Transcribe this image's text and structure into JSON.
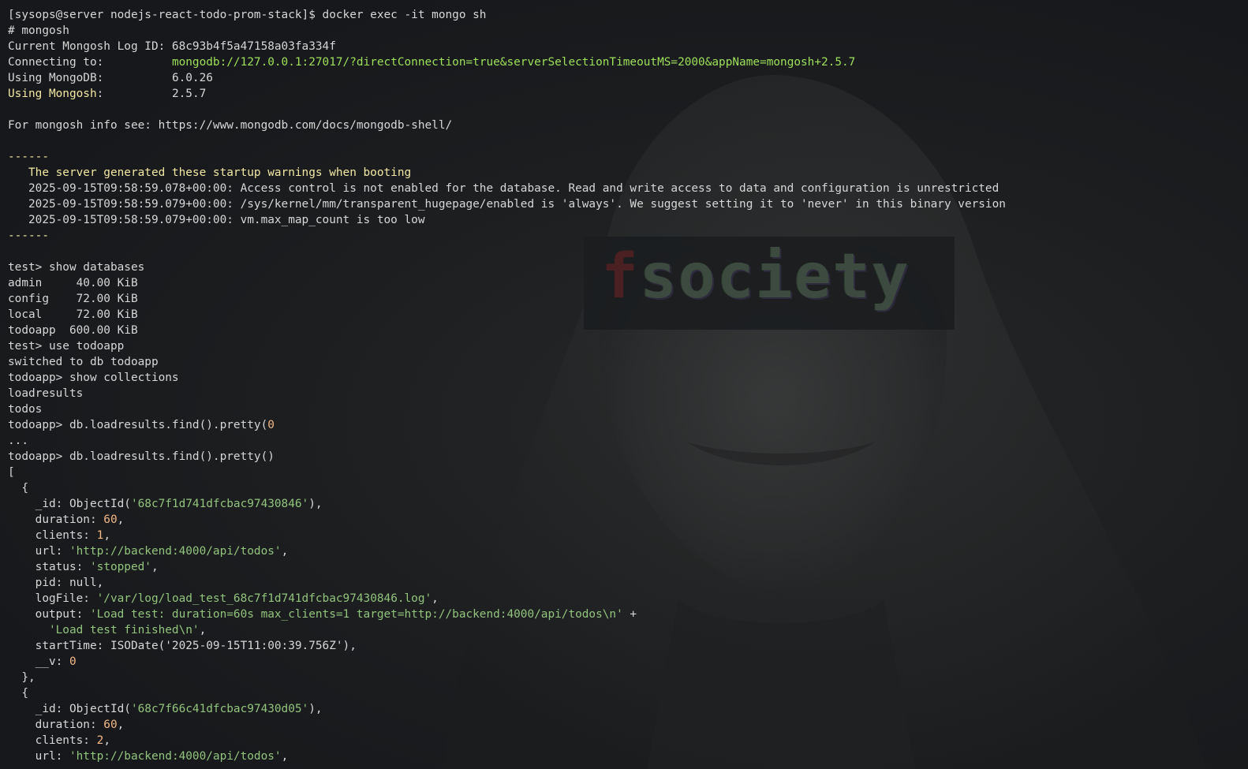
{
  "colors": {
    "background": "#16181b",
    "text": "#d6d8d7",
    "url": "#9ee05a",
    "highlight": "#f2e8a4",
    "string": "#93c47d",
    "number": "#f4b887"
  },
  "wallpaper": {
    "logo_first": "f",
    "logo_rest": "society"
  },
  "session": {
    "prompt_cmd": "[sysops@server nodejs-react-todo-prom-stack]$ docker exec -it mongo sh",
    "shell_cmd": "# mongosh",
    "log_id": "Current Mongosh Log ID: 68c93b4f5a47158a03fa334f",
    "connecting_label": "Connecting to:          ",
    "connecting_url": "mongodb://127.0.0.1:27017/?directConnection=true&serverSelectionTimeoutMS=2000&appName=mongosh+2.5.7",
    "mongodb_label": "Using MongoDB:          ",
    "mongodb_version": "6.0.26",
    "mongosh_label": "Using Mongosh",
    "mongosh_sep": ":          ",
    "mongosh_version": "2.5.7",
    "info_line": "For mongosh info see: https://www.mongodb.com/docs/mongodb-shell/",
    "dashes": "------",
    "warn_title": "   The server generated these startup warnings when booting",
    "warn_1": "   2025-09-15T09:58:59.078+00:00: Access control is not enabled for the database. Read and write access to data and configuration is unrestricted",
    "warn_2": "   2025-09-15T09:58:59.079+00:00: /sys/kernel/mm/transparent_hugepage/enabled is 'always'. We suggest setting it to 'never' in this binary version",
    "warn_3": "   2025-09-15T09:58:59.079+00:00: vm.max_map_count is too low",
    "cmd_show_dbs": "test> show databases",
    "db_admin": "admin     40.00 KiB",
    "db_config": "config    72.00 KiB",
    "db_local": "local     72.00 KiB",
    "db_todoapp": "todoapp  600.00 KiB",
    "cmd_use": "test> use todoapp",
    "switched": "switched to db todoapp",
    "cmd_show_cols": "todoapp> show collections",
    "col_loadresults": "loadresults",
    "col_todos": "todos",
    "cmd_find_bad": "todoapp> db.loadresults.find().pretty(",
    "cmd_find_bad_tail": "0",
    "continuation": "...",
    "cmd_find": "todoapp> db.loadresults.find().pretty()",
    "open_bracket": "[",
    "open_brace": "  {",
    "close_brace_comma": "  },"
  },
  "record1": {
    "id_prefix": "    _id: ObjectId(",
    "id_value": "'68c7f1d741dfcbac97430846'",
    "id_suffix": "),",
    "duration_key": "    duration: ",
    "duration": "60",
    "clients_key": "    clients: ",
    "clients": "1",
    "url_key": "    url: ",
    "url": "'http://backend:4000/api/todos'",
    "status_key": "    status: ",
    "status": "'stopped'",
    "pid_line": "    pid: null,",
    "logfile_key": "    logFile: ",
    "logfile": "'/var/log/load_test_68c7f1d741dfcbac97430846.log'",
    "output_key": "    output: ",
    "output_1": "'Load test: duration=60s max_clients=1 target=http://backend:4000/api/todos\\n'",
    "plus": " +",
    "output_indent": "      ",
    "output_2": "'Load test finished\\n'",
    "starttime_line": "    startTime: ISODate('2025-09-15T11:00:39.756Z'),",
    "v_key": "    __v: ",
    "v": "0"
  },
  "record2": {
    "id_prefix": "    _id: ObjectId(",
    "id_value": "'68c7f66c41dfcbac97430d05'",
    "id_suffix": "),",
    "duration_key": "    duration: ",
    "duration": "60",
    "clients_key": "    clients: ",
    "clients": "2",
    "url_key": "    url: ",
    "url": "'http://backend:4000/api/todos'"
  }
}
